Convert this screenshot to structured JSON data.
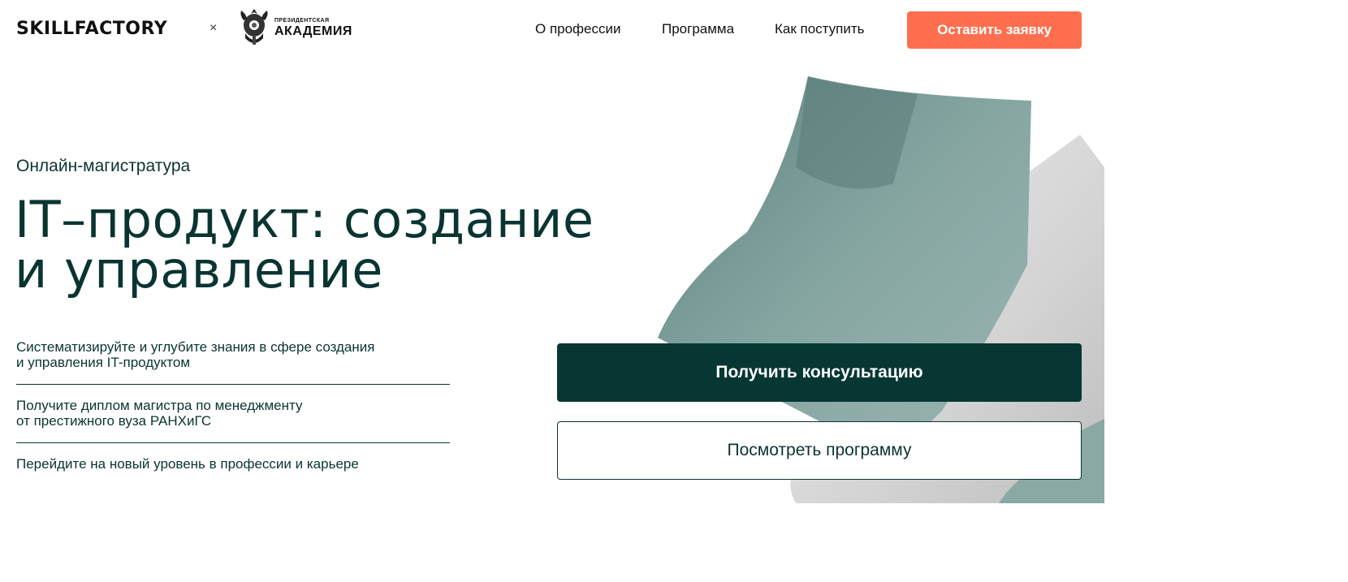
{
  "header": {
    "logo": "SKILLFACTORY",
    "separator": "×",
    "partner_small": "ПРЕЗИДЕНТСКАЯ",
    "partner_big": "АКАДЕМИЯ",
    "nav": [
      "О профессии",
      "Программа",
      "Как поступить"
    ],
    "cta": "Оставить заявку"
  },
  "hero": {
    "eyebrow": "Онлайн-магистратура",
    "title_line1": "IT–продукт: создание",
    "title_line2": "и управление",
    "benefits": [
      {
        "line1": "Систематизируйте и углубите знания в сфере создания",
        "line2": "и управления IT-продуктом"
      },
      {
        "line1": "Получите диплом магистра по менеджменту",
        "line2": "от престижного вуза РАНХиГС"
      },
      {
        "line1": "Перейдите на новый уровень в профессии и карьере",
        "line2": ""
      }
    ],
    "primary_button": "Получить консультацию",
    "secondary_button": "Посмотреть программу"
  },
  "colors": {
    "accent": "#ff6f4f",
    "dark_green": "#063733",
    "text": "#0a3431",
    "art_teal": "#7e9e9a",
    "art_grey": "#d9d9d9"
  },
  "icons": {
    "partner_logo": "academy-emblem-icon"
  }
}
